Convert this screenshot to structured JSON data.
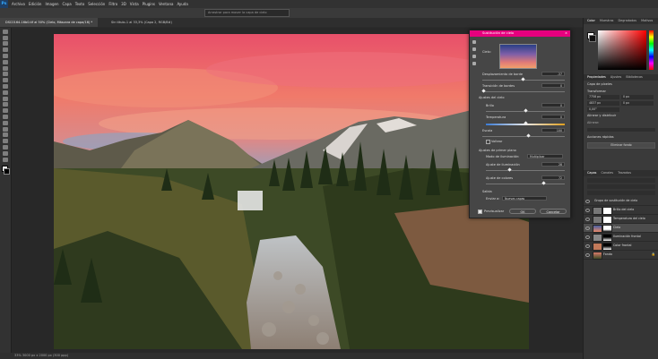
{
  "app": {
    "logo": "Ps"
  },
  "menu": [
    "Archivo",
    "Edición",
    "Imagen",
    "Capa",
    "Texto",
    "Selección",
    "Filtro",
    "3D",
    "Vista",
    "Plugins",
    "Ventana",
    "Ayuda"
  ],
  "options_hint": "Arrastrar para mover la capa de cielo",
  "tabs": [
    {
      "label": "DSC0164-16b0.tif al 50% (Cielo, Máscara de capa/16) *"
    },
    {
      "label": "Sin título-1 al 33,3% (Capa 2, RGB/8#)"
    }
  ],
  "status": "33%       3000 px x 2000 px (300 ppp)",
  "right_tabs": {
    "color": [
      "Color",
      "Muestras",
      "Degradados",
      "Motivos"
    ],
    "props": [
      "Propiedades",
      "Ajustes",
      "Bibliotecas"
    ],
    "layers": [
      "Capas",
      "Canales",
      "Trazados"
    ]
  },
  "properties": {
    "kind": "Capa de píxeles",
    "transform": "Transformar",
    "w": "7758 px",
    "h": "4837 px",
    "x": "0 px",
    "y": "0 px",
    "angle": "0,00°",
    "align": "Alinear y distribuir",
    "align_sub": "Alinear:",
    "quick": "Acciones rápidas",
    "remove_bg": "Eliminar fondo"
  },
  "layers_panel": {
    "items": [
      {
        "name": "Grupo de sustitución de cielo"
      },
      {
        "name": "Brillo del cielo"
      },
      {
        "name": "Temperatura del cielo"
      },
      {
        "name": "Cielo"
      },
      {
        "name": "Iluminación frontal"
      },
      {
        "name": "Color frontal"
      },
      {
        "name": "Fondo"
      }
    ]
  },
  "dialog": {
    "title": "Sustitución de cielo",
    "close": "×",
    "sky_label": "Cielo:",
    "edge_shift_label": "Desplazamiento de borde",
    "edge_shift": "-37",
    "fade_label": "Transición de bordes",
    "fade": "0",
    "sky_adjust_label": "Ajustes del cielo",
    "brightness_label": "Brillo",
    "brightness": "0",
    "temperature_label": "Temperatura",
    "temperature": "0",
    "scale_label": "Escala",
    "scale": "100",
    "flip_label": "Voltear",
    "fg_label": "Ajustes de primer plano",
    "light_mode_label": "Modo de iluminación:",
    "light_mode": "Multiplicar",
    "light_adjust_label": "Ajuste de iluminación",
    "light_adjust": "28",
    "color_adjust_label": "Ajuste de colores",
    "color_adjust": "72",
    "output_label": "Salida",
    "output_to_label": "Enviar a:",
    "output_to": "Nuevas capas",
    "preview_label": "Previsualizar",
    "ok": "OK",
    "cancel": "Cancelar",
    "colors": {
      "accent": "#e6007e"
    }
  }
}
